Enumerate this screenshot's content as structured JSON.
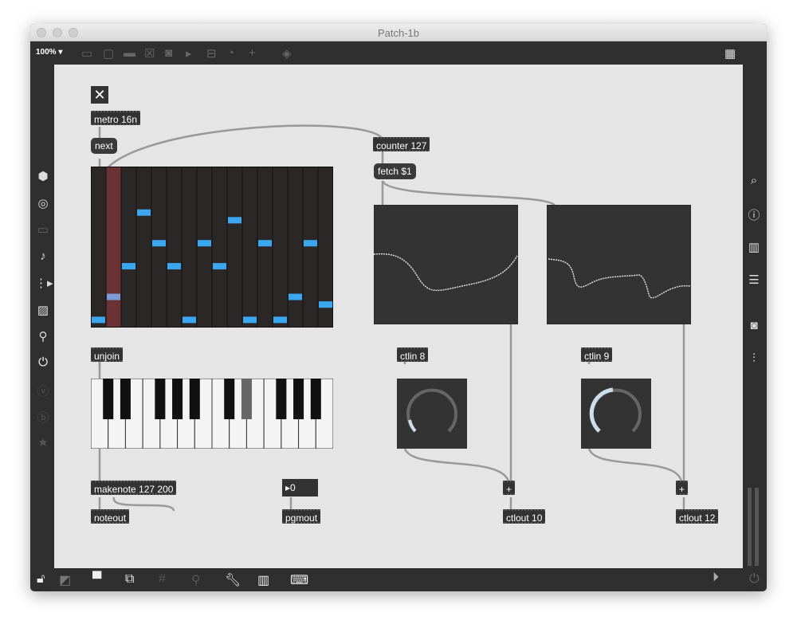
{
  "window": {
    "title": "Patch-1b",
    "zoom": "100%"
  },
  "toolbar_icons": [
    "presentation-icon",
    "object-icon",
    "comment-icon",
    "toggle-icon",
    "button-icon",
    "message-icon",
    "number-icon",
    "dial-icon",
    "add-icon",
    "paint-bucket-icon"
  ],
  "left_sidebar_icons": [
    "package-icon",
    "target-icon",
    "slider-icon",
    "music-note-icon",
    "sequence-icon",
    "image-icon",
    "paperclip-icon",
    "plug-icon",
    "vimeo-icon",
    "b-icon",
    "star-icon"
  ],
  "right_sidebar_icons": [
    "search-icon",
    "info-icon",
    "book-icon",
    "list-icon",
    "snapshot-icon",
    "mixer-icon"
  ],
  "bottom_icons": [
    "lock-icon",
    "edit-icon",
    "presentation-icon",
    "windows-icon",
    "grid-icon",
    "paperclip-add-icon",
    "wrench-icon",
    "piano-icon",
    "keyboard-icon"
  ],
  "objects": {
    "metro": "metro 16n",
    "next": "next",
    "counter": "counter 127",
    "fetch": "fetch $1",
    "unjoin": "unjoin",
    "ctlin8": "ctlin 8",
    "ctlin9": "ctlin 9",
    "makenote": "makenote 127 200",
    "noteout": "noteout",
    "number": "0",
    "pgmout": "pgmout",
    "plus1": "+",
    "plus2": "+",
    "ctlout10": "ctlout 10",
    "ctlout12": "ctlout 12"
  },
  "toggle": {
    "on": true
  },
  "sequencer": {
    "columns": 16,
    "rows": 21,
    "current_step": 1,
    "steps": [
      0,
      3,
      7,
      14,
      10,
      7,
      0,
      10,
      7,
      13,
      0,
      10,
      0,
      3,
      10,
      2
    ]
  },
  "keyboard": {
    "white_keys": 14,
    "held_key": "D#2"
  },
  "dials": {
    "ctlin8": 0.05,
    "ctlin9": 0.4
  },
  "colors": {
    "note": "#3aa7f0",
    "playhead": "#6b3234",
    "canvas": "#e5e5e5",
    "box": "#333333"
  }
}
